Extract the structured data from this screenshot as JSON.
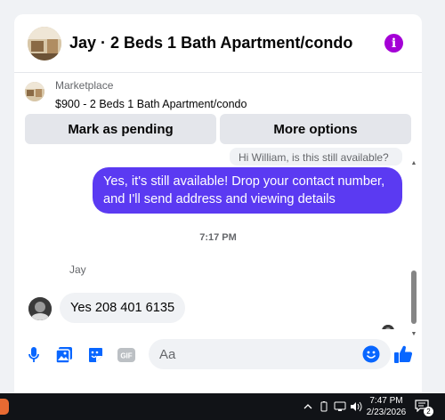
{
  "header": {
    "title": "Jay · 2 Beds 1 Bath Apartment/condo",
    "info_icon": "info-icon"
  },
  "listing": {
    "source": "Marketplace",
    "price_title": "$900 - 2 Beds 1 Bath Apartment/condo"
  },
  "actions": {
    "mark_pending": "Mark as pending",
    "more_options": "More options"
  },
  "messages": {
    "reply_preview": "Hi William, is this still available?",
    "outgoing": "Yes, it's still available! Drop your contact number, and I'll send address and viewing details",
    "timestamp": "7:17 PM",
    "sender_name": "Jay",
    "incoming": "Yes 208 401 6135"
  },
  "composer": {
    "placeholder": "Aa",
    "tools": [
      "microphone-icon",
      "photo-icon",
      "sticker-icon",
      "gif-icon"
    ],
    "gif_label": "GIF",
    "emoji_icon": "emoji-icon",
    "like_icon": "thumbs-up-icon"
  },
  "taskbar": {
    "time": "7:47 PM",
    "date": "2/23/2026",
    "notification_count": "2"
  },
  "colors": {
    "accent": "#0866ff",
    "outgoing_bubble": "#5b3af2",
    "info": "#a400d6"
  }
}
